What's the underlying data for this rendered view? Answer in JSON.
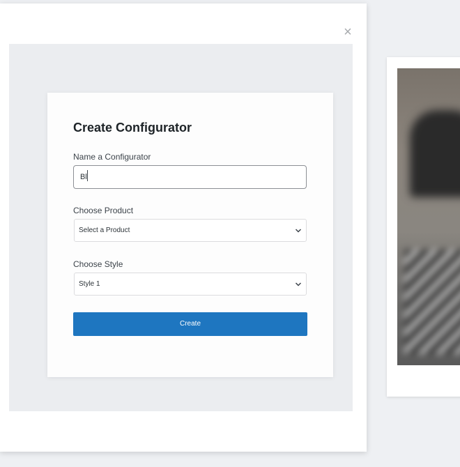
{
  "modal": {
    "close_label": "×",
    "title": "Create Configurator",
    "name_field": {
      "label": "Name a Configurator",
      "value": "Bl"
    },
    "product_field": {
      "label": "Choose Product",
      "selected": "Select a Product"
    },
    "style_field": {
      "label": "Choose Style",
      "selected": "Style 1"
    },
    "create_label": "Create"
  },
  "colors": {
    "primary_button": "#1e76c0",
    "input_border": "#8c8f94"
  },
  "icons": [
    "close-icon",
    "chevron-down-icon",
    "text-cursor-icon"
  ]
}
